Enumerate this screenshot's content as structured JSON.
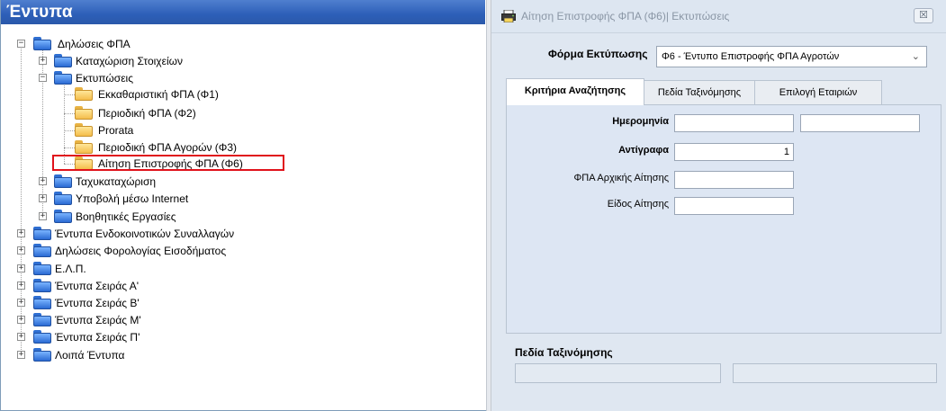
{
  "left_panel": {
    "title": "Έντυπα",
    "tree": [
      {
        "label": "Δηλώσεις ΦΠΑ",
        "expander": "−",
        "color": "blue"
      },
      {
        "label": "Καταχώριση Στοιχείων",
        "expander": "+",
        "color": "blue"
      },
      {
        "label": "Εκτυπώσεις",
        "expander": "−",
        "color": "blue"
      },
      {
        "label": "Εκκαθαριστική ΦΠΑ (Φ1)",
        "expander": "",
        "color": "yellow"
      },
      {
        "label": "Περιοδική ΦΠΑ (Φ2)",
        "expander": "",
        "color": "yellow"
      },
      {
        "label": "Prorata",
        "expander": "",
        "color": "yellow"
      },
      {
        "label": "Περιοδική ΦΠΑ Αγορών (Φ3)",
        "expander": "",
        "color": "yellow"
      },
      {
        "label": "Αίτηση Επιστροφής ΦΠΑ (Φ6)",
        "expander": "",
        "color": "yellow"
      },
      {
        "label": "Ταχυκαταχώριση",
        "expander": "+",
        "color": "blue"
      },
      {
        "label": "Υποβολή μέσω Internet",
        "expander": "+",
        "color": "blue"
      },
      {
        "label": "Βοηθητικές Εργασίες",
        "expander": "+",
        "color": "blue"
      },
      {
        "label": "Έντυπα Ενδοκοινοτικών Συναλλαγών",
        "expander": "+",
        "color": "blue"
      },
      {
        "label": "Δηλώσεις Φορολογίας Εισοδήματος",
        "expander": "+",
        "color": "blue"
      },
      {
        "label": "Ε.Λ.Π.",
        "expander": "+",
        "color": "blue"
      },
      {
        "label": "Έντυπα Σειράς Α'",
        "expander": "+",
        "color": "blue"
      },
      {
        "label": "Έντυπα Σειράς Β'",
        "expander": "+",
        "color": "blue"
      },
      {
        "label": "Έντυπα Σειράς Μ'",
        "expander": "+",
        "color": "blue"
      },
      {
        "label": "Έντυπα Σειράς Π'",
        "expander": "+",
        "color": "blue"
      },
      {
        "label": "Λοιπά Έντυπα",
        "expander": "+",
        "color": "blue"
      }
    ],
    "highlight_color": "#e0121b"
  },
  "dialog": {
    "title": "Αίτηση Επιστροφής ΦΠΑ (Φ6)| Εκτυπώσεις",
    "close_glyph": "☒",
    "form_label": "Φόρμα Εκτύπωσης",
    "form_value": "Φ6 -  Έντυπο Επιστροφής ΦΠΑ Αγροτών",
    "tabs": {
      "criteria": "Κριτήρια Αναζήτησης",
      "sort": "Πεδία Ταξινόμησης",
      "companies": "Επιλογή Εταιριών"
    },
    "criteria": {
      "date_label": "Ημερομηνία",
      "date_from": "",
      "date_to": "",
      "copies_label": "Αντίγραφα",
      "copies_value": "1",
      "vat_label": "ΦΠΑ Αρχικής Αίτησης",
      "vat_value": "",
      "type_label": "Είδος Αίτησης",
      "type_value": ""
    },
    "sort_section_label": "Πεδία Ταξινόμησης"
  }
}
